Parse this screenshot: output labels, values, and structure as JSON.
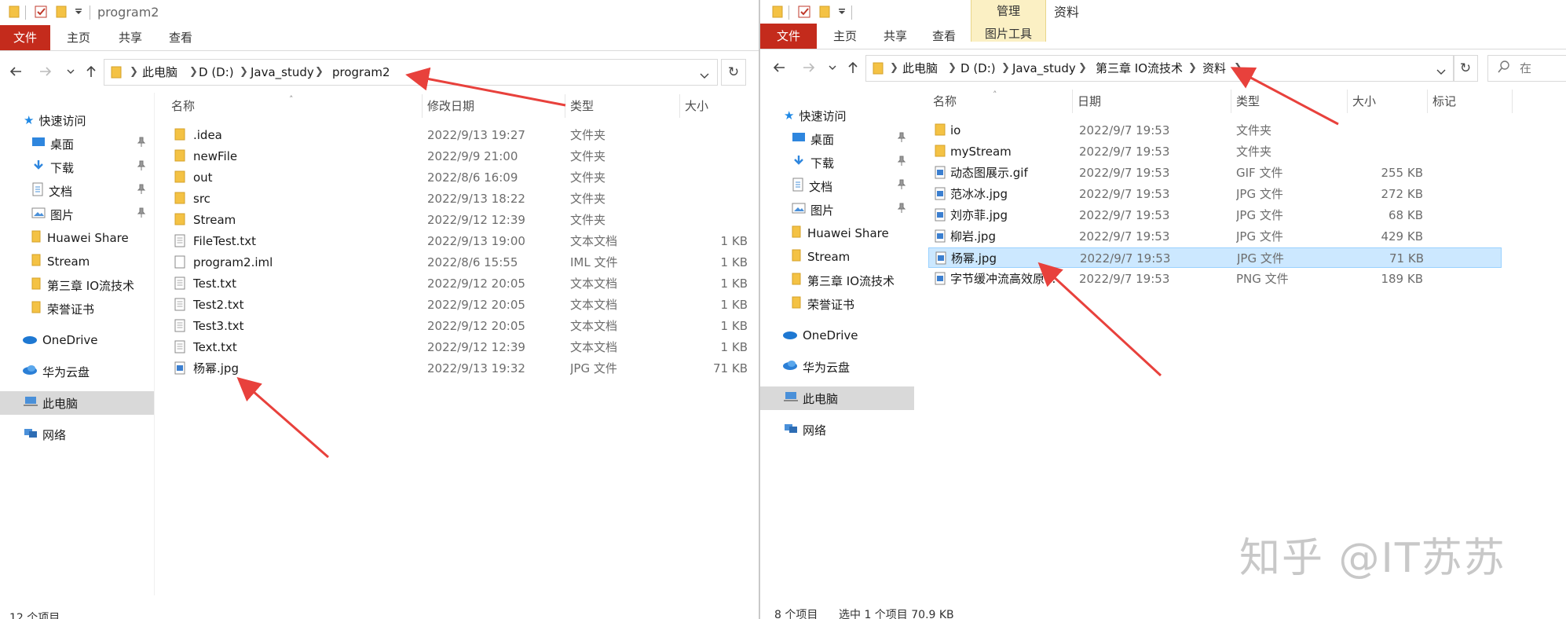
{
  "left_window": {
    "title": "program2",
    "ribbon_tabs": [
      "文件",
      "主页",
      "共享",
      "查看"
    ],
    "breadcrumb": [
      "此电脑",
      "D (D:)",
      "Java_study",
      "program2"
    ],
    "nav": {
      "quick_access": "快速访问",
      "pinned": [
        "桌面",
        "下载",
        "文档",
        "图片"
      ],
      "folders": [
        "Huawei Share",
        "Stream",
        "第三章 IO流技术",
        "荣誉证书"
      ],
      "onedrive": "OneDrive",
      "huawei_cloud": "华为云盘",
      "this_pc": "此电脑",
      "network": "网络"
    },
    "columns": [
      "名称",
      "修改日期",
      "类型",
      "大小"
    ],
    "files": [
      {
        "name": ".idea",
        "date": "2022/9/13 19:27",
        "type": "文件夹",
        "size": "",
        "icon": "folder-icon"
      },
      {
        "name": "newFile",
        "date": "2022/9/9 21:00",
        "type": "文件夹",
        "size": "",
        "icon": "folder-icon"
      },
      {
        "name": "out",
        "date": "2022/8/6 16:09",
        "type": "文件夹",
        "size": "",
        "icon": "folder-icon"
      },
      {
        "name": "src",
        "date": "2022/9/13 18:22",
        "type": "文件夹",
        "size": "",
        "icon": "folder-icon"
      },
      {
        "name": "Stream",
        "date": "2022/9/12 12:39",
        "type": "文件夹",
        "size": "",
        "icon": "folder-icon"
      },
      {
        "name": "FileTest.txt",
        "date": "2022/9/13 19:00",
        "type": "文本文档",
        "size": "1 KB",
        "icon": "text-file-icon"
      },
      {
        "name": "program2.iml",
        "date": "2022/8/6 15:55",
        "type": "IML 文件",
        "size": "1 KB",
        "icon": "file-icon"
      },
      {
        "name": "Test.txt",
        "date": "2022/9/12 20:05",
        "type": "文本文档",
        "size": "1 KB",
        "icon": "text-file-icon"
      },
      {
        "name": "Test2.txt",
        "date": "2022/9/12 20:05",
        "type": "文本文档",
        "size": "1 KB",
        "icon": "text-file-icon"
      },
      {
        "name": "Test3.txt",
        "date": "2022/9/12 20:05",
        "type": "文本文档",
        "size": "1 KB",
        "icon": "text-file-icon"
      },
      {
        "name": "Text.txt",
        "date": "2022/9/12 12:39",
        "type": "文本文档",
        "size": "1 KB",
        "icon": "text-file-icon"
      },
      {
        "name": "杨幂.jpg",
        "date": "2022/9/13 19:32",
        "type": "JPG 文件",
        "size": "71 KB",
        "icon": "image-file-icon"
      }
    ],
    "status": "12 个项目"
  },
  "right_window": {
    "title": "资料",
    "ribbon_tabs": [
      "文件",
      "主页",
      "共享",
      "查看"
    ],
    "tools_tab": "管理",
    "tools_sub": "图片工具",
    "breadcrumb": [
      "此电脑",
      "D (D:)",
      "Java_study",
      "第三章 IO流技术",
      "资料"
    ],
    "search_placeholder": "在",
    "nav": {
      "quick_access": "快速访问",
      "pinned": [
        "桌面",
        "下载",
        "文档",
        "图片"
      ],
      "folders": [
        "Huawei Share",
        "Stream",
        "第三章 IO流技术",
        "荣誉证书"
      ],
      "onedrive": "OneDrive",
      "huawei_cloud": "华为云盘",
      "this_pc": "此电脑",
      "network": "网络"
    },
    "columns": [
      "名称",
      "日期",
      "类型",
      "大小",
      "标记"
    ],
    "files": [
      {
        "name": "io",
        "date": "2022/9/7 19:53",
        "type": "文件夹",
        "size": "",
        "icon": "folder-icon"
      },
      {
        "name": "myStream",
        "date": "2022/9/7 19:53",
        "type": "文件夹",
        "size": "",
        "icon": "folder-icon"
      },
      {
        "name": "动态图展示.gif",
        "date": "2022/9/7 19:53",
        "type": "GIF 文件",
        "size": "255 KB",
        "icon": "image-file-icon"
      },
      {
        "name": "范冰冰.jpg",
        "date": "2022/9/7 19:53",
        "type": "JPG 文件",
        "size": "272 KB",
        "icon": "image-file-icon"
      },
      {
        "name": "刘亦菲.jpg",
        "date": "2022/9/7 19:53",
        "type": "JPG 文件",
        "size": "68 KB",
        "icon": "image-file-icon"
      },
      {
        "name": "柳岩.jpg",
        "date": "2022/9/7 19:53",
        "type": "JPG 文件",
        "size": "429 KB",
        "icon": "image-file-icon"
      },
      {
        "name": "杨幂.jpg",
        "date": "2022/9/7 19:53",
        "type": "JPG 文件",
        "size": "71 KB",
        "icon": "image-file-icon",
        "selected": true
      },
      {
        "name": "字节缓冲流高效原...",
        "date": "2022/9/7 19:53",
        "type": "PNG 文件",
        "size": "189 KB",
        "icon": "image-file-icon"
      }
    ],
    "status_count": "8 个项目",
    "status_selected": "选中 1 个项目  70.9 KB"
  },
  "watermark": "知乎 @IT苏苏",
  "colors": {
    "file_tab": "#c42b1c",
    "selection": "#cce8ff",
    "arrow": "#e8413c",
    "folder": "#f4c244"
  }
}
